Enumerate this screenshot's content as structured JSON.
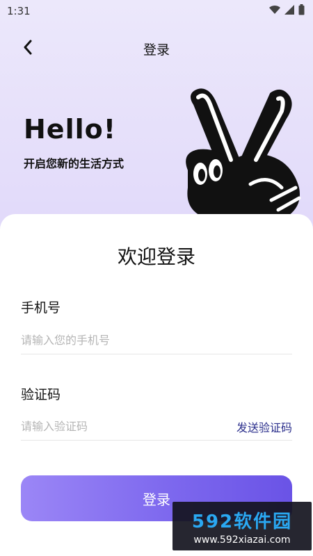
{
  "status_bar": {
    "time": "1:31",
    "icons": [
      "wifi-icon",
      "signal-icon",
      "battery-icon"
    ]
  },
  "nav": {
    "back_icon": "chevron-left-icon",
    "title": "登录"
  },
  "hero": {
    "greeting": "Hello!",
    "subtitle": "开启您新的生活方式",
    "illustration": "peace-hand-illustration"
  },
  "form": {
    "welcome": "欢迎登录",
    "phone": {
      "label": "手机号",
      "placeholder": "请输入您的手机号",
      "value": ""
    },
    "code": {
      "label": "验证码",
      "placeholder": "请输入验证码",
      "value": "",
      "send_label": "发送验证码"
    },
    "submit_label": "登录"
  },
  "watermark": {
    "brand": "592软件园",
    "url": "www.592xiazai.com"
  },
  "colors": {
    "accent": "#7d68ee",
    "link": "#2b2f8c",
    "background_top": "#ece8fb",
    "background_bottom": "#cbbdf3"
  }
}
